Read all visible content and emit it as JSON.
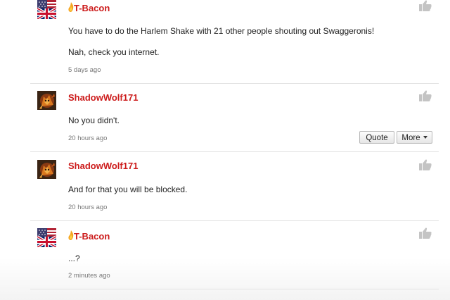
{
  "comments": [
    {
      "username": "T-Bacon",
      "lines": [
        "You have to do the Harlem Shake with 21 other people shouting out Swaggeronis!",
        "Nah, check you internet."
      ],
      "time": "5 days ago",
      "avatar_icon": "uk-us-flag-icon"
    },
    {
      "username": "ShadowWolf171",
      "lines": [
        "No you didn't."
      ],
      "time": "20 hours ago",
      "avatar_icon": "wolf-avatar-icon",
      "actions": {
        "quote_label": "Quote",
        "more_label": "More"
      }
    },
    {
      "username": "ShadowWolf171",
      "lines": [
        "And for that you will be blocked."
      ],
      "time": "20 hours ago",
      "avatar_icon": "wolf-avatar-icon"
    },
    {
      "username": "T-Bacon",
      "lines": [
        "...?"
      ],
      "time": "2 minutes ago",
      "avatar_icon": "uk-us-flag-icon"
    }
  ],
  "colors": {
    "username": "#cc1b1b",
    "text": "#222222",
    "time": "#777777",
    "divider": "#e2e2e2"
  }
}
